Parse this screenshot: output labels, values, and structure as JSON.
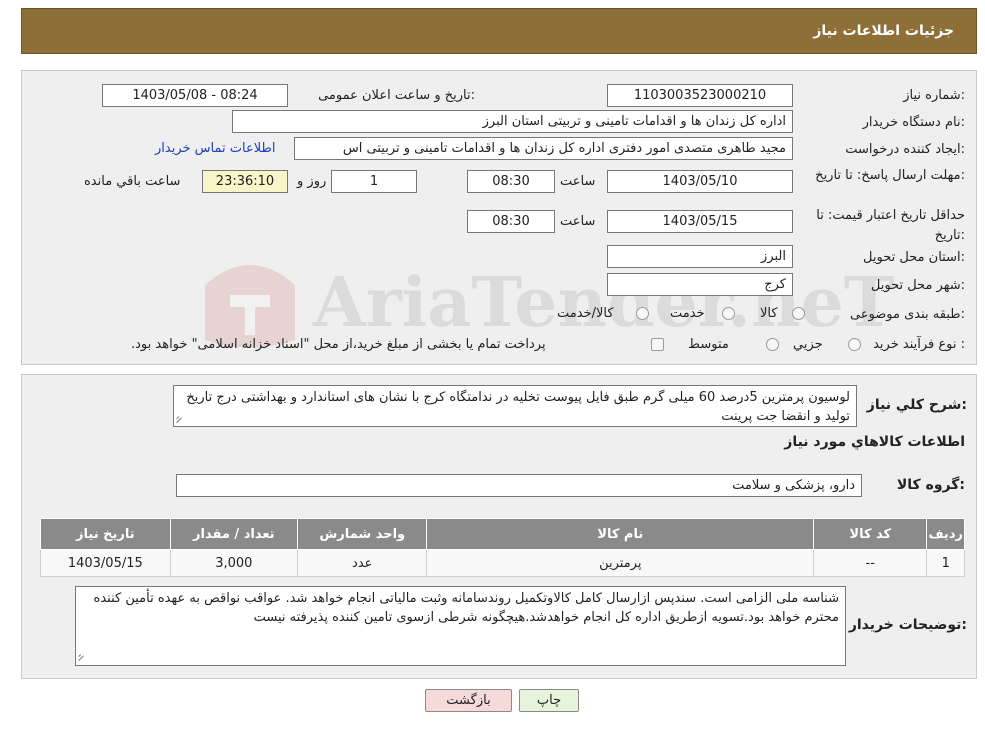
{
  "header": {
    "title": "جزئیات اطلاعات نیاز"
  },
  "form": {
    "need_number_label": "شماره نیاز:",
    "need_number": "1103003523000210",
    "announce_label": "تاریخ و ساعت اعلان عمومی:",
    "announce_value": "1403/05/08 - 08:24",
    "buyer_org_label": "نام دستگاه خریدار:",
    "buyer_org": "اداره کل زندان ها و اقدامات تامینی و تربیتی استان البرز",
    "requester_label": "ایجاد کننده درخواست:",
    "requester": "مجید طاهری متصدی امور دفتری اداره کل زندان ها و اقدامات تامینی و تربیتی اس",
    "contact_link": "اطلاعات تماس خریدار",
    "reply_deadline_label": "مهلت ارسال پاسخ: تا تاریخ:",
    "reply_date": "1403/05/10",
    "time_label": "ساعت",
    "reply_time": "08:30",
    "days_value": "1",
    "days_label": "روز و",
    "remaining_time": "23:36:10",
    "remaining_label": "ساعت باقي مانده",
    "validity_label": "حداقل تاریخ اعتبار قیمت: تا تاریخ:",
    "validity_date": "1403/05/15",
    "validity_time": "08:30",
    "province_label": "استان محل تحویل:",
    "province": "البرز",
    "city_label": "شهر محل تحویل:",
    "city": "کرج",
    "category_label": "طبقه بندی موضوعی:",
    "category_options": [
      "کالا",
      "خدمت",
      "کالا/خدمت"
    ],
    "process_label": "نوع فرآیند خرید :",
    "process_options": [
      "جزیي",
      "متوسط"
    ],
    "payment_note": "پرداخت تمام یا بخشی از مبلغ خرید،از محل \"اسناد خزانه اسلامی\" خواهد بود."
  },
  "description": {
    "label": "شرح كلي نياز:",
    "text": "لوسیون پرمترین 5درصد 60 میلی گرم طبق فایل پیوست تخلیه در ندامتگاه کرج با نشان های استاندارد و بهداشتی درج تاریخ تولید و انقضا جت پرینت"
  },
  "goods": {
    "section_title": "اطلاعات كالاهاي مورد نياز",
    "group_label": "گروه کالا:",
    "group_value": "دارو، پزشکی و سلامت",
    "columns": [
      "ردیف",
      "کد کالا",
      "نام کالا",
      "واحد شمارش",
      "تعداد / مقدار",
      "تاریخ نیاز"
    ],
    "rows": [
      [
        "1",
        "--",
        "پرمترین",
        "عدد",
        "3,000",
        "1403/05/15"
      ]
    ]
  },
  "buyer_notes": {
    "label": "توضیحات خریدار:",
    "text": "شناسه ملی الزامی است. سندپس ازارسال کامل کالاوتکمیل روندسامانه وثبت مالیاتی انجام خواهد شد. عواقب نواقص به عهده تأمین کننده محترم خواهد بود.تسویه ازطریق اداره کل انجام خواهدشد.هیچگونه شرطی ازسوی تامین کننده پذیرفته نیست"
  },
  "buttons": {
    "print": "چاپ",
    "back": "بازگشت"
  },
  "watermark": {
    "text": "AriaTender.neT"
  },
  "colors": {
    "header_bg": "#8f6f38",
    "table_header_bg": "#8a8a8a",
    "back_button_bg": "#f6d9d9",
    "print_button_bg": "#e6f4dc",
    "link": "#1b3dbf"
  }
}
